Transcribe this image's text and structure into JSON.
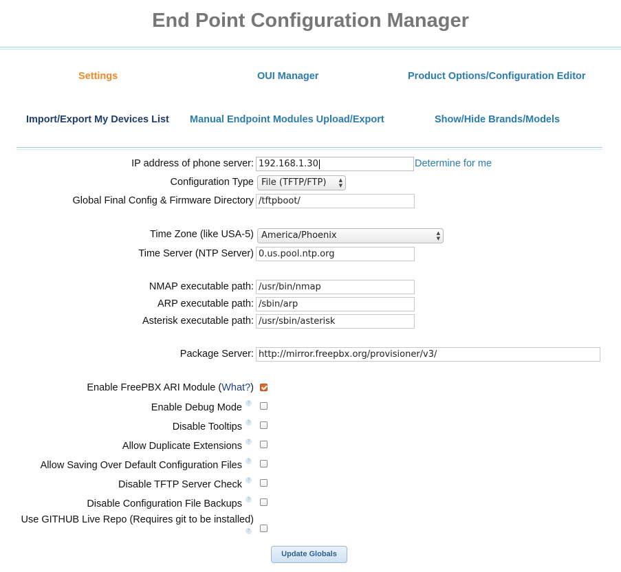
{
  "page": {
    "title": "End Point Configuration Manager"
  },
  "nav": {
    "row1": [
      {
        "label": "Settings"
      },
      {
        "label": "OUI Manager"
      },
      {
        "label": "Product Options/Configuration Editor"
      }
    ],
    "row2": [
      {
        "label": "Import/Export My Devices List"
      },
      {
        "label": "Manual Endpoint Modules Upload/Export"
      },
      {
        "label": "Show/Hide Brands/Models"
      }
    ]
  },
  "form": {
    "ip_label": "IP address of phone server:",
    "ip_value": "192.168.1.30",
    "determine_link": "Determine for me",
    "config_type_label": "Configuration Type",
    "config_type_value": "File (TFTP/FTP)",
    "directory_label": "Global Final Config & Firmware Directory",
    "directory_value": "/tftpboot/",
    "timezone_label": "Time Zone (like USA-5)",
    "timezone_value": "America/Phoenix",
    "timeserver_label": "Time Server (NTP Server)",
    "timeserver_value": "0.us.pool.ntp.org",
    "nmap_label": "NMAP executable path:",
    "nmap_value": "/usr/bin/nmap",
    "arp_label": "ARP executable path:",
    "arp_value": "/sbin/arp",
    "asterisk_label": "Asterisk executable path:",
    "asterisk_value": "/usr/sbin/asterisk",
    "package_label": "Package Server:",
    "package_value": "http://mirror.freepbx.org/provisioner/v3/"
  },
  "options": {
    "ari_label": "Enable FreePBX ARI Module (",
    "ari_what": "What?",
    "ari_close": ")",
    "ari_checked": true,
    "debug_label": "Enable Debug Mode",
    "tooltips_label": "Disable Tooltips",
    "duplicate_label": "Allow Duplicate Extensions",
    "saving_label": "Allow Saving Over Default Configuration Files",
    "tftp_label": "Disable TFTP Server Check",
    "backups_label": "Disable Configuration File Backups",
    "github_label": "Use GITHUB Live Repo (Requires git to be installed)"
  },
  "help_icon_glyph": "?",
  "submit_label": "Update Globals",
  "colors": {
    "active_nav": "#f08a2c",
    "nav": "#2a7bb0",
    "title": "#777777",
    "checkbox_checked": "#e06a2e"
  }
}
